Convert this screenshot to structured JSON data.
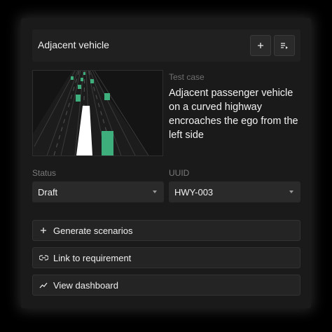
{
  "header": {
    "title": "Adjacent vehicle",
    "add_icon": "plus-icon",
    "queue_icon": "playlist-play-icon"
  },
  "test_case": {
    "label": "Test case",
    "description": "Adjacent passenger vehicle on a curved highway encroaches the ego from the left side"
  },
  "fields": {
    "status": {
      "label": "Status",
      "value": "Draft"
    },
    "uuid": {
      "label": "UUID",
      "value": "HWY-003"
    }
  },
  "actions": [
    {
      "label": "Generate scenarios",
      "icon": "plus-icon"
    },
    {
      "label": "Link to requirement",
      "icon": "link-icon"
    },
    {
      "label": "View dashboard",
      "icon": "trend-line-icon"
    }
  ],
  "colors": {
    "vehicle_green": "#3dae7c",
    "ego_white": "#ffffff",
    "card_bg": "#1a1a1a"
  }
}
